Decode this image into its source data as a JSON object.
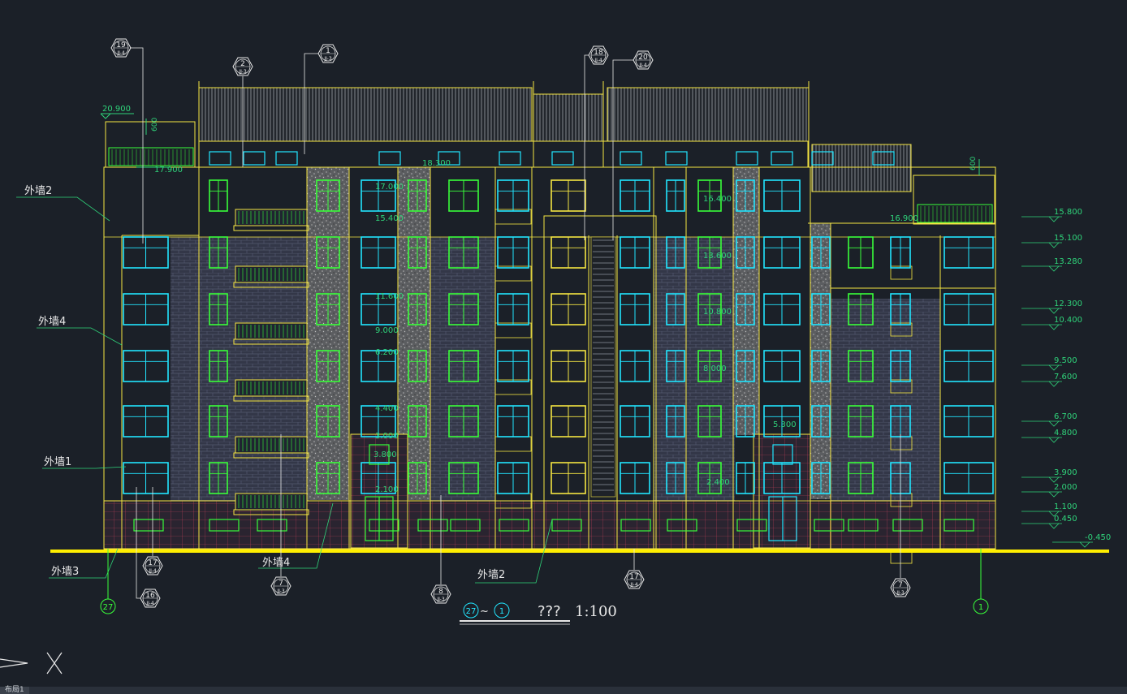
{
  "title": "???",
  "axis_range": "27~1",
  "axis_from": "27",
  "axis_to": "1",
  "scale": "1:100",
  "layout_tab": "布局1",
  "materials": {
    "wall1": "外墙1",
    "wall2": "外墙2",
    "wall3": "外墙3",
    "wall4": "外墙4"
  },
  "top_callouts": [
    {
      "num": "19",
      "sheet": "JJ-4"
    },
    {
      "num": "2",
      "sheet": "JJ-3"
    },
    {
      "num": "1",
      "sheet": "JJ-3"
    },
    {
      "num": "18",
      "sheet": "JJ-4"
    },
    {
      "num": "20",
      "sheet": "JJ-4"
    }
  ],
  "bottom_callouts": [
    {
      "num": "17",
      "sheet": "JJ-4"
    },
    {
      "num": "16",
      "sheet": "JJ-4"
    },
    {
      "num": "7",
      "sheet": "JJ-3"
    },
    {
      "num": "8",
      "sheet": "JJ-3"
    },
    {
      "num": "17",
      "sheet": "JJ-4"
    },
    {
      "num": "7",
      "sheet": "JJ-3"
    }
  ],
  "right_elevations": [
    "15.800",
    "15.100",
    "13.280",
    "12.300",
    "10.400",
    "9.500",
    "7.600",
    "6.700",
    "4.800",
    "3.900",
    "2.000",
    "1.100",
    "0.450",
    "-0.450"
  ],
  "left_elevations": [
    "20.900",
    "17.900"
  ],
  "facade_levels": [
    "18.300",
    "17.000",
    "16.400",
    "15.400",
    "13.600",
    "11.600",
    "10.800",
    "9.000",
    "8.000",
    "6.200",
    "5.300",
    "4.400",
    "3.800",
    "3.000",
    "2.400",
    "2.100",
    "16.900"
  ],
  "dims": [
    "600",
    "600"
  ],
  "colors": {
    "background": "#1b2028",
    "outline": "#f5e642",
    "window": "#22e6ff",
    "window_green": "#39ff3a",
    "brick": "#33364a",
    "stucco": "#6a6a6a",
    "annotation": "#2fd37a",
    "ground": "#ffee00"
  }
}
